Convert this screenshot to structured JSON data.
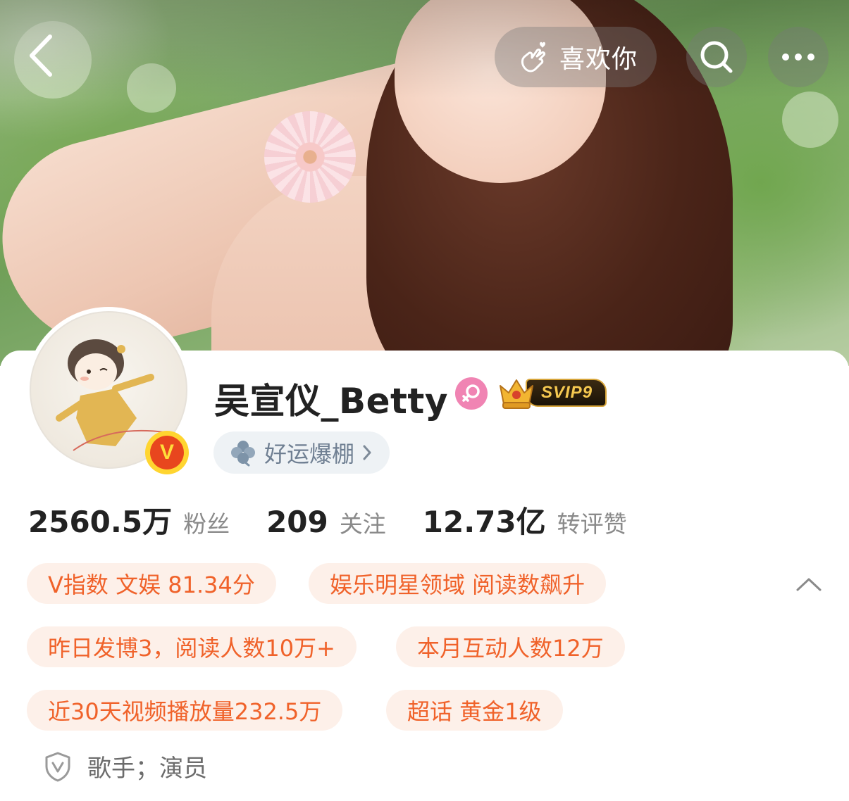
{
  "header": {
    "back_icon": "chevron-left-icon",
    "like_label": "喜欢你",
    "like_icon": "finger-heart-icon",
    "search_icon": "search-icon",
    "more_icon": "more-dots-icon"
  },
  "profile": {
    "username": "吴宣仪_Betty",
    "gender": "female",
    "vip_badge": "SVIP9",
    "verified_badge_letter": "V",
    "luck_chip_label": "好运爆棚",
    "accent_color": "#f0622a"
  },
  "stats": [
    {
      "value": "2560.5万",
      "label": "粉丝"
    },
    {
      "value": "209",
      "label": "关注"
    },
    {
      "value": "12.73亿",
      "label": "转评赞"
    }
  ],
  "tags": [
    {
      "label": "V指数 文娱 81.34分"
    },
    {
      "label": "娱乐明星领域 阅读数飙升"
    },
    {
      "label": "昨日发博3，阅读人数10万+"
    },
    {
      "label": "本月互动人数12万"
    },
    {
      "label": "近30天视频播放量232.5万"
    },
    {
      "label": "超话 黄金1级"
    }
  ],
  "bio": {
    "icon": "verified-shield-icon",
    "text": "歌手；演员"
  }
}
